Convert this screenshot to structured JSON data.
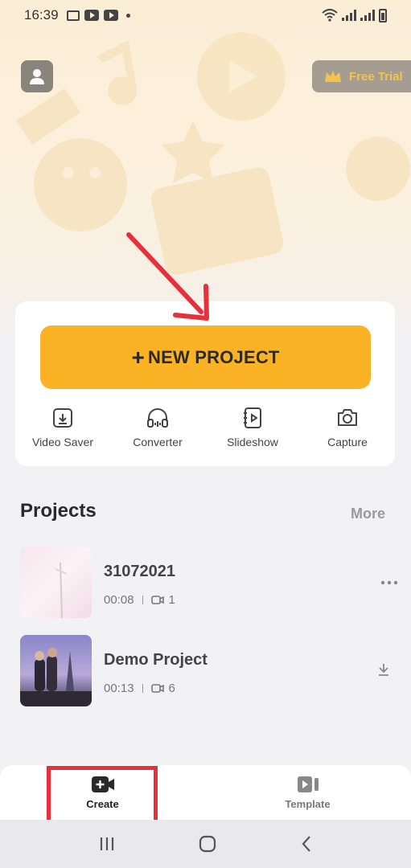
{
  "status": {
    "time": "16:39"
  },
  "header": {
    "trial_label": "Free Trial"
  },
  "main": {
    "new_project_label": "NEW PROJECT",
    "tools": [
      {
        "label": "Video Saver",
        "icon": "download-box-icon"
      },
      {
        "label": "Converter",
        "icon": "headphones-icon"
      },
      {
        "label": "Slideshow",
        "icon": "slideshow-icon"
      },
      {
        "label": "Capture",
        "icon": "camera-icon"
      }
    ]
  },
  "projects": {
    "title": "Projects",
    "more_label": "More",
    "items": [
      {
        "name": "31072021",
        "duration": "00:08",
        "clips": "1",
        "action": "more-options-icon"
      },
      {
        "name": "Demo Project",
        "duration": "00:13",
        "clips": "6",
        "action": "download-icon"
      }
    ]
  },
  "bottom_nav": {
    "create_label": "Create",
    "template_label": "Template"
  },
  "colors": {
    "accent": "#fbb225",
    "highlight": "#e8303a",
    "trial_text": "#f5c24a"
  }
}
